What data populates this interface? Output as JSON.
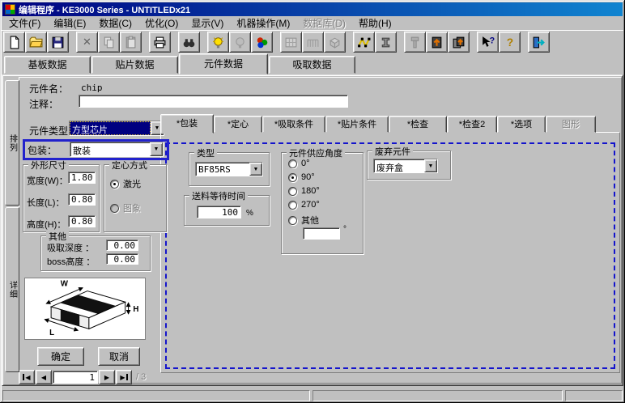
{
  "window": {
    "title": "编辑程序 - KE3000 Series - UNTITLEDx21"
  },
  "menu": {
    "items": [
      {
        "label": "文件(F)",
        "enabled": true
      },
      {
        "label": "编辑(E)",
        "enabled": true
      },
      {
        "label": "数据(C)",
        "enabled": true
      },
      {
        "label": "优化(O)",
        "enabled": true
      },
      {
        "label": "显示(V)",
        "enabled": true
      },
      {
        "label": "机器操作(M)",
        "enabled": true
      },
      {
        "label": "数据库(D)",
        "enabled": false
      },
      {
        "label": "帮助(H)",
        "enabled": true
      }
    ]
  },
  "toolbar": {
    "buttons": [
      {
        "name": "new-file",
        "enabled": true
      },
      {
        "name": "open-file",
        "enabled": true
      },
      {
        "name": "save",
        "enabled": true
      },
      {
        "name": "delete",
        "enabled": false
      },
      {
        "name": "copy",
        "enabled": false
      },
      {
        "name": "paste",
        "enabled": false
      },
      {
        "name": "print",
        "enabled": true
      },
      {
        "name": "find",
        "enabled": true
      },
      {
        "name": "hint-bulb",
        "enabled": true
      },
      {
        "name": "lamp-off",
        "enabled": false
      },
      {
        "name": "optimize",
        "enabled": true
      },
      {
        "name": "board",
        "enabled": false
      },
      {
        "name": "feeder",
        "enabled": false
      },
      {
        "name": "component-box",
        "enabled": false
      },
      {
        "name": "route",
        "enabled": true
      },
      {
        "name": "ibeam",
        "enabled": true
      },
      {
        "name": "nozzle",
        "enabled": false
      },
      {
        "name": "download",
        "enabled": true
      },
      {
        "name": "download-all",
        "enabled": true
      },
      {
        "name": "context-help",
        "enabled": true
      },
      {
        "name": "help",
        "enabled": true
      },
      {
        "name": "exit",
        "enabled": true
      }
    ]
  },
  "main_tabs": {
    "items": [
      {
        "label": "基板数据",
        "active": false
      },
      {
        "label": "贴片数据",
        "active": false
      },
      {
        "label": "元件数据",
        "active": true
      },
      {
        "label": "吸取数据",
        "active": false
      }
    ]
  },
  "side_tabs": {
    "items": [
      {
        "label": "排列"
      },
      {
        "label": "详细"
      }
    ]
  },
  "form": {
    "name_label": "元件名：",
    "name_value": "chip",
    "comment_label": "注释：",
    "comment_value": "",
    "type_label": "元件类型：",
    "type_value": "方型芯片",
    "package_label": "包装：",
    "package_value": "散装"
  },
  "dims": {
    "title": "外形尺寸",
    "rows": [
      {
        "label": "宽度(W)：",
        "value": "1.80"
      },
      {
        "label": "长度(L)：",
        "value": "0.80"
      },
      {
        "label": "高度(H)：",
        "value": "0.80"
      }
    ]
  },
  "centering": {
    "title": "定心方式",
    "options": [
      {
        "label": "激光",
        "selected": true,
        "enabled": true
      },
      {
        "label": "图象",
        "selected": false,
        "enabled": false
      }
    ]
  },
  "other": {
    "title": "其他",
    "rows": [
      {
        "label": "吸取深度 ：",
        "value": "0.00"
      },
      {
        "label": "boss高度 ：",
        "value": "0.00"
      }
    ]
  },
  "diagram": {
    "w": "W",
    "h": "H",
    "l": "L"
  },
  "actions": {
    "ok": "确定",
    "cancel": "取消"
  },
  "pager": {
    "value": "1",
    "total": "/ 3",
    "first": "◀",
    "prev": "◀",
    "next": "▶",
    "last": "▶"
  },
  "sub_tabs": {
    "items": [
      {
        "label": "*包装",
        "active": true,
        "enabled": true
      },
      {
        "label": "*定心",
        "active": false,
        "enabled": true
      },
      {
        "label": "*吸取条件",
        "active": false,
        "enabled": true
      },
      {
        "label": "*贴片条件",
        "active": false,
        "enabled": true
      },
      {
        "label": "*检查",
        "active": false,
        "enabled": true
      },
      {
        "label": "*检查2",
        "active": false,
        "enabled": true
      },
      {
        "label": "*选项",
        "active": false,
        "enabled": true
      },
      {
        "label": "图形",
        "active": false,
        "enabled": false
      }
    ]
  },
  "package_page": {
    "type_group": {
      "title": "类型",
      "value": "BF85RS"
    },
    "feed_group": {
      "title": "送料等待时间",
      "value": "100",
      "unit": "%"
    },
    "angle_group": {
      "title": "元件供应角度",
      "options": [
        {
          "label": "0°",
          "selected": false
        },
        {
          "label": "90°",
          "selected": true
        },
        {
          "label": "180°",
          "selected": false
        },
        {
          "label": "270°",
          "selected": false
        },
        {
          "label": "其他",
          "selected": false
        }
      ],
      "other_value": "",
      "unit": "°"
    },
    "discard_group": {
      "title": "废弃元件",
      "value": "废弃盒"
    }
  },
  "glyphs": {
    "dropdown": "▼"
  },
  "colors": {
    "titlebar_left": "#000080",
    "titlebar_right": "#1084d0",
    "chrome": "#c0c0c0",
    "selection": "#000080",
    "focus_blue": "#2222cc",
    "dashed_blue": "#1414cc"
  }
}
